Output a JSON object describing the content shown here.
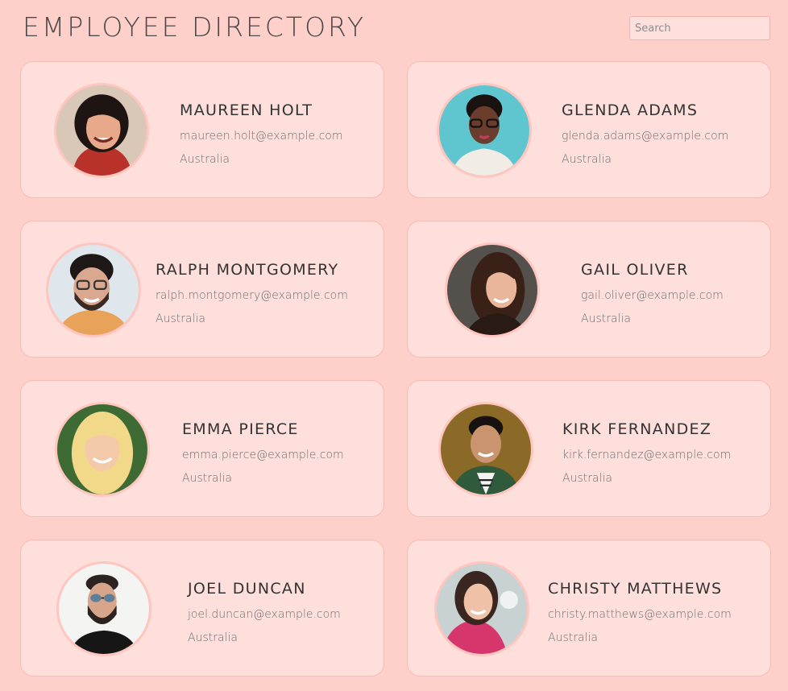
{
  "header": {
    "title": "EMPLOYEE DIRECTORY",
    "search_placeholder": "Search"
  },
  "employees": [
    {
      "name": "MAUREEN HOLT",
      "email": "maureen.holt@example.com",
      "location": "Australia"
    },
    {
      "name": "GLENDA ADAMS",
      "email": "glenda.adams@example.com",
      "location": "Australia"
    },
    {
      "name": "RALPH MONTGOMERY",
      "email": "ralph.montgomery@example.com",
      "location": "Australia"
    },
    {
      "name": "GAIL OLIVER",
      "email": "gail.oliver@example.com",
      "location": "Australia"
    },
    {
      "name": "EMMA PIERCE",
      "email": "emma.pierce@example.com",
      "location": "Australia"
    },
    {
      "name": "KIRK FERNANDEZ",
      "email": "kirk.fernandez@example.com",
      "location": "Australia"
    },
    {
      "name": "JOEL DUNCAN",
      "email": "joel.duncan@example.com",
      "location": "Australia"
    },
    {
      "name": "CHRISTY MATTHEWS",
      "email": "christy.matthews@example.com",
      "location": "Australia"
    }
  ],
  "colors": {
    "background": "#ffcfca",
    "card": "#ffdfdb",
    "card_border": "#f6bdb6",
    "avatar_ring": "#ffc6bf"
  }
}
